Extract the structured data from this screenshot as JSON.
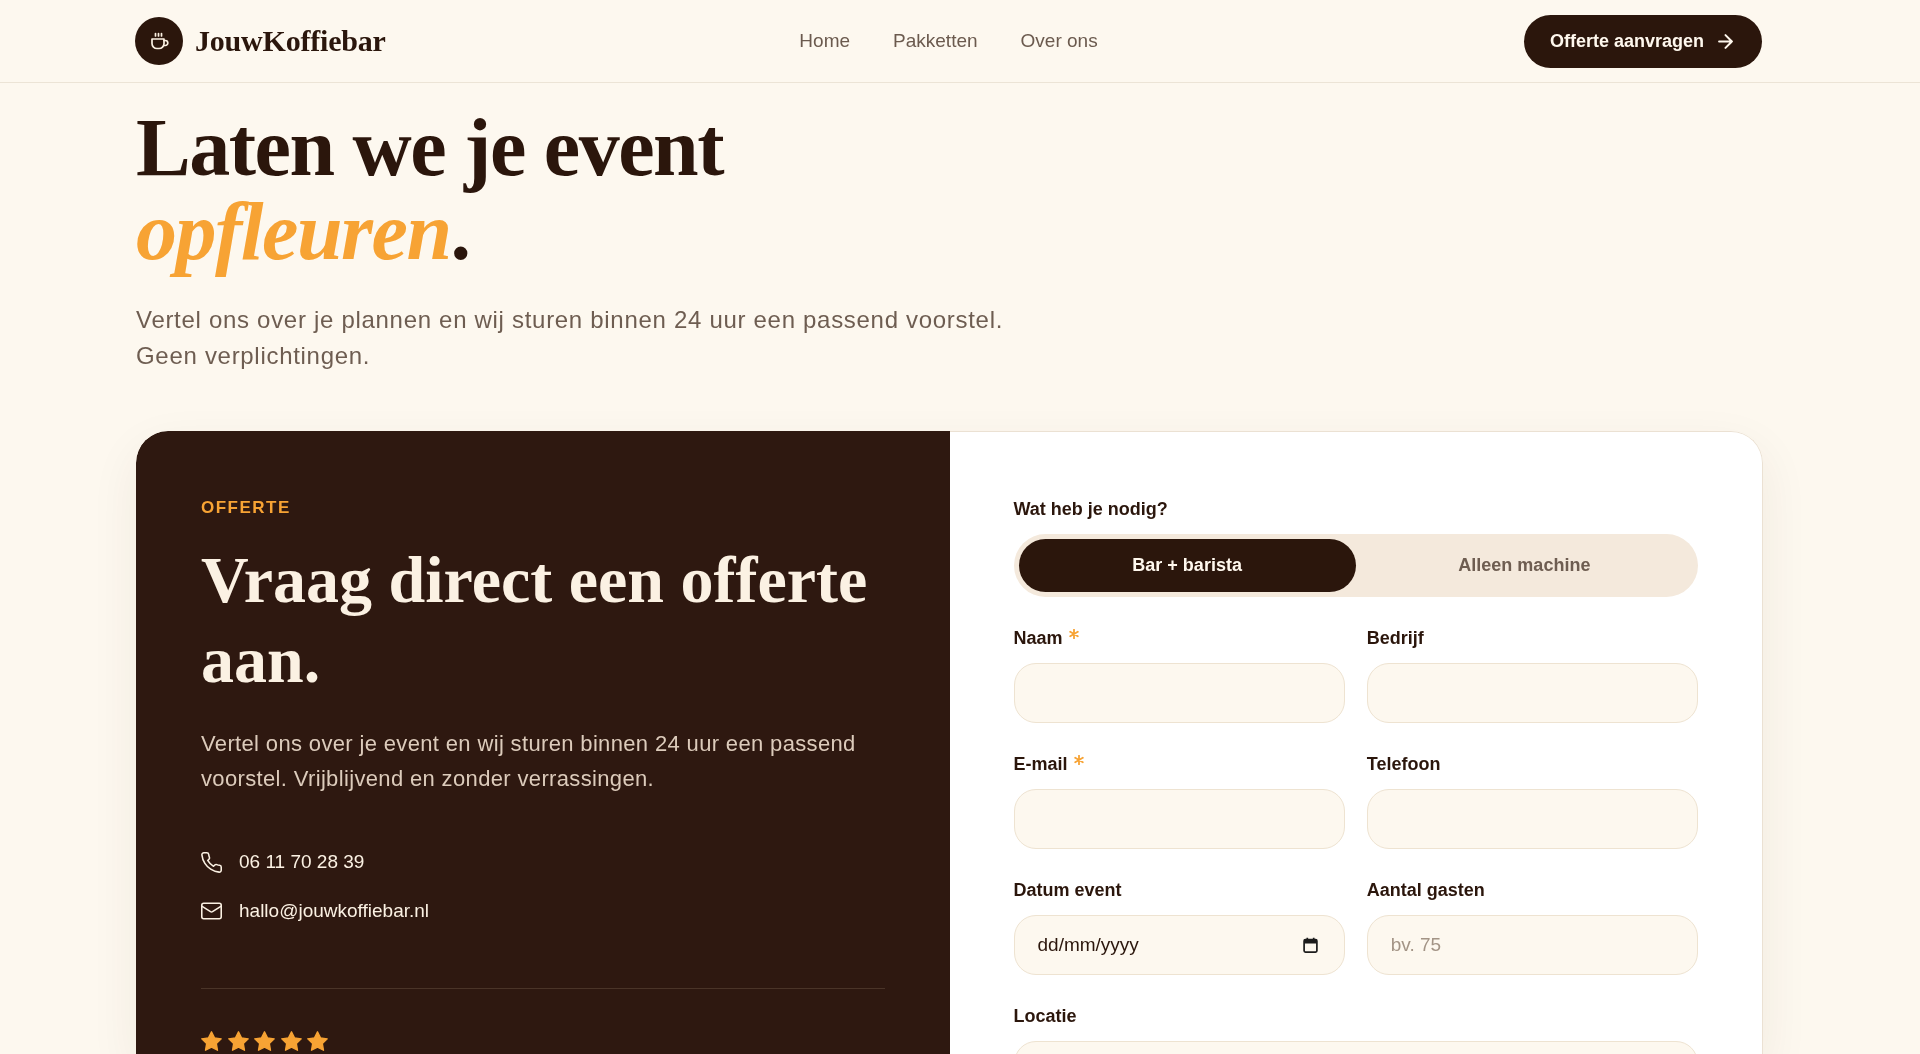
{
  "header": {
    "logo": {
      "text": "JouwKoffiebar"
    },
    "nav": [
      {
        "label": "Home"
      },
      {
        "label": "Pakketten"
      },
      {
        "label": "Over ons"
      }
    ],
    "cta": {
      "label": "Offerte aanvragen"
    }
  },
  "hero": {
    "title": "Laten we je event *opfleuren*.",
    "intro": "Vertel ons over je plannen en wij sturen binnen 24 uur een passend voorstel. Geen verplichtingen."
  },
  "quote_panel": {
    "eyebrow": "OFFERTE",
    "title": "Vraag direct een offerte aan.",
    "text": "Vertel ons over je event en wij sturen binnen 24 uur een passend voorstel. Vrijblijvend en zonder verrassingen.",
    "contacts": [
      {
        "kind": "phone",
        "text": "06 11 70 28 39"
      },
      {
        "kind": "email",
        "text": "hallo@jouwkoffiebar.nl"
      }
    ],
    "rating": {
      "stars": 5
    }
  },
  "form": {
    "question": "Wat heb je nodig?",
    "options": [
      {
        "label": "Bar + barista",
        "selected": true
      },
      {
        "label": "Alleen machine",
        "selected": false
      }
    ],
    "rows": [
      [
        {
          "label": "Naam",
          "required": true,
          "kind": "text"
        },
        {
          "label": "Bedrijf",
          "required": false,
          "kind": "text"
        }
      ],
      [
        {
          "label": "E-mail",
          "required": true,
          "kind": "text"
        },
        {
          "label": "Telefoon",
          "required": false,
          "kind": "text"
        }
      ],
      [
        {
          "label": "Datum event",
          "required": false,
          "kind": "date",
          "placeholder": "dd/mm/yyyy"
        },
        {
          "label": "Aantal gasten",
          "required": false,
          "kind": "text",
          "placeholder": "bv. 75"
        }
      ],
      [
        {
          "label": "Locatie",
          "required": false,
          "kind": "text"
        }
      ]
    ]
  }
}
